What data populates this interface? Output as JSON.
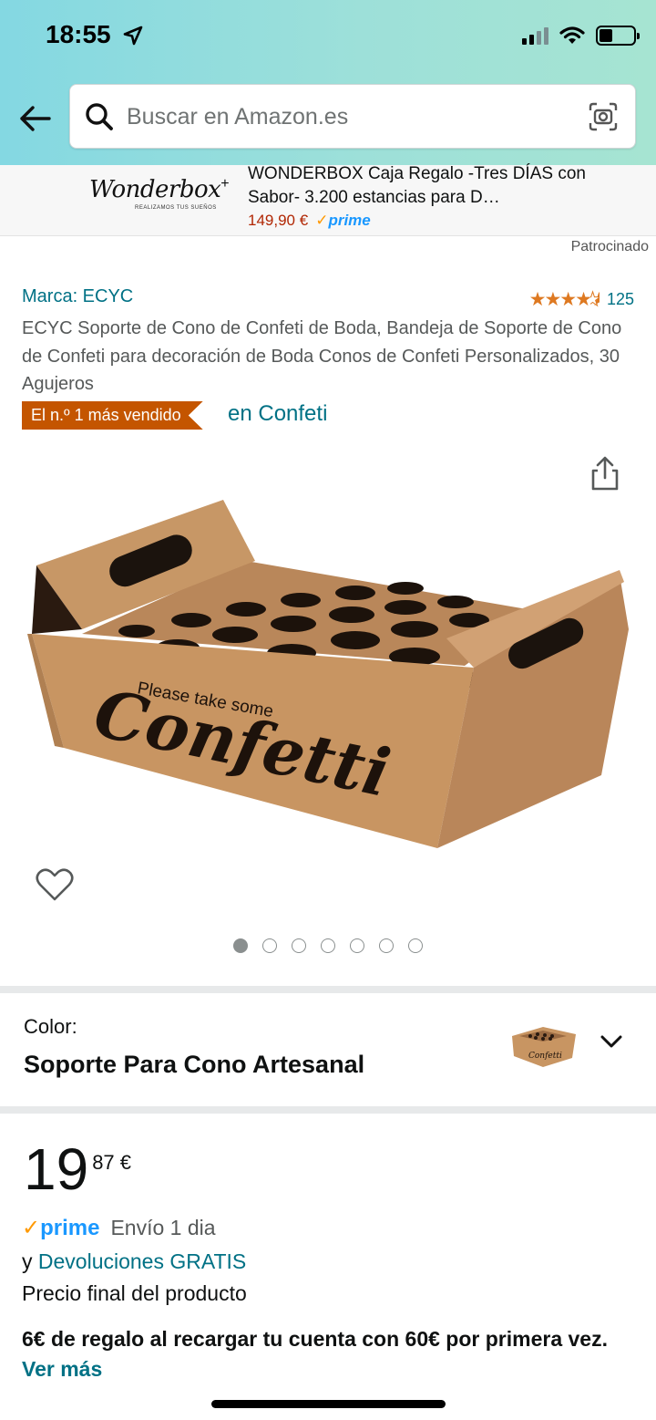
{
  "status_bar": {
    "time": "18:55"
  },
  "search": {
    "placeholder": "Buscar en Amazon.es"
  },
  "sponsored_banner": {
    "brand_logo_text": "Wonderbox",
    "brand_tagline": "REALIZAMOS TUS SUEÑOS",
    "title": "WONDERBOX Caja Regalo -Tres DÍAS con Sabor- 3.200 estancias para D…",
    "price": "149,90 €",
    "prime": "prime",
    "sponsored_label": "Patrocinado"
  },
  "product": {
    "brand_label": "Marca: ECYC",
    "rating_stars": 4.5,
    "rating_count": "125",
    "title": "ECYC Soporte de Cono de Confeti de Boda, Bandeja de Soporte de Cono de Confeti para decoración de Boda Conos de Confeti Personalizados, 30 Agujeros",
    "bestseller_badge": "El n.º 1 más vendido",
    "bestseller_category": "en Confeti",
    "image_text_top": "Please take some",
    "image_text_main": "Confetti",
    "image_count": 7,
    "image_active_index": 0
  },
  "color": {
    "label": "Color:",
    "value": "Soporte Para Cono Artesanal"
  },
  "price": {
    "whole": "19",
    "fraction": "87 €",
    "prime": "prime",
    "delivery": "Envío 1 dia",
    "returns_prefix": "y ",
    "returns_link": "Devoluciones GRATIS",
    "final_price_note": "Precio final del producto",
    "promo_text": "6€ de regalo al recargar tu cuenta con 60€ por primera vez. ",
    "promo_link": "Ver más"
  },
  "colors": {
    "link": "#007185",
    "badge": "#c45500",
    "star": "#de7921",
    "prime_blue": "#1a98ff",
    "deal_red": "#b12704"
  }
}
